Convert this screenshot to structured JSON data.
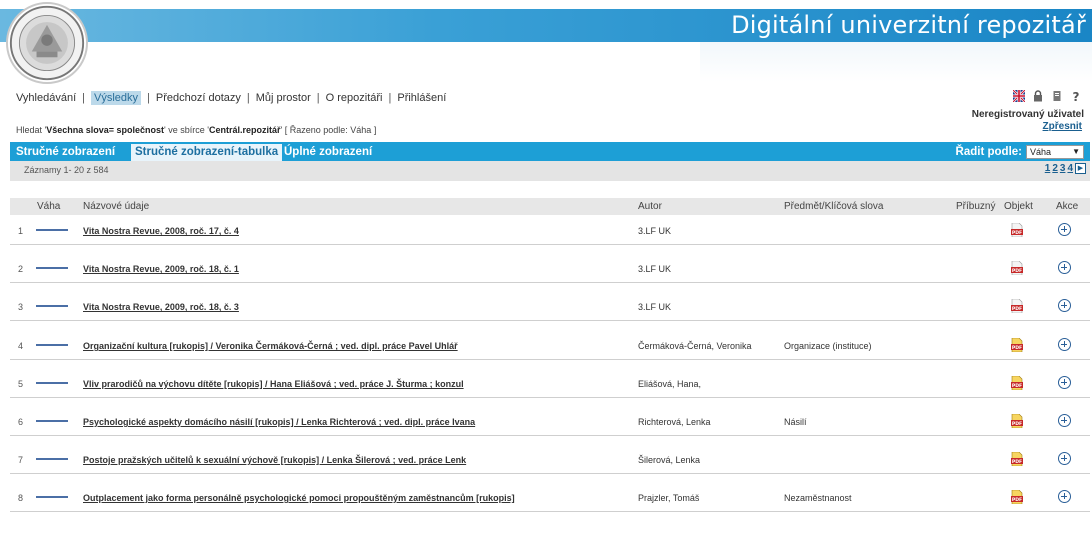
{
  "header": {
    "title": "Digitální univerzitní repozitář"
  },
  "nav": {
    "items": [
      {
        "label": "Vyhledávání"
      },
      {
        "label": "Výsledky"
      },
      {
        "label": "Předchozí dotazy"
      },
      {
        "label": "Můj prostor"
      },
      {
        "label": "O repozitáři"
      },
      {
        "label": "Přihlášení"
      }
    ]
  },
  "user": {
    "label": "Neregistrovaný uživatel",
    "refine": "Zpřesnit"
  },
  "query": {
    "prefix": "Hledat '",
    "term": "Všechna slova= společnost",
    "mid": "' ve sbírce '",
    "collection": "Centrál.repozitář",
    "suffix": "' [ Řazeno podle: Váha ]"
  },
  "tabs": {
    "brief": "Stručné zobrazení",
    "brief_table": "Stručné zobrazení-tabulka",
    "full": "Úplné zobrazení"
  },
  "sort": {
    "label": "Řadit podle:",
    "value": "Váha"
  },
  "records": {
    "count": "Záznamy 1- 20 z 584",
    "pages": [
      "1",
      "2",
      "3",
      "4"
    ]
  },
  "table": {
    "headers": {
      "weight": "Váha",
      "title": "Názvové údaje",
      "author": "Autor",
      "subject": "Předmět/Klíčová slova",
      "related": "Příbuzný",
      "object": "Objekt",
      "action": "Akce"
    },
    "rows": [
      {
        "num": "1",
        "title": "Vita Nostra Revue, 2008, roč. 17, č. 4",
        "author": "3.LF UK",
        "subject": "",
        "weight": 1.0
      },
      {
        "num": "2",
        "title": "Vita Nostra Revue, 2009, roč. 18, č. 1",
        "author": "3.LF UK",
        "subject": "",
        "weight": 1.0
      },
      {
        "num": "3",
        "title": "Vita Nostra Revue, 2009, roč. 18, č. 3",
        "author": "3.LF UK",
        "subject": "",
        "weight": 1.0
      },
      {
        "num": "4",
        "title": "Organizační kultura [rukopis] / Veronika Čermáková-Černá ; ved. dipl. práce Pavel Uhlář",
        "author": "Čermáková-Černá, Veronika",
        "subject": "Organizace (instituce)",
        "weight": 1.0
      },
      {
        "num": "5",
        "title": "Vliv prarodičů na výchovu dítěte [rukopis] / Hana Eliášová ; ved. práce J. Šturma ; konzul",
        "author": "Eliášová, Hana,",
        "subject": "",
        "weight": 1.0
      },
      {
        "num": "6",
        "title": "Psychologické aspekty domácího násilí [rukopis] / Lenka Richterová ; ved. dipl. práce Ivana",
        "author": "Richterová, Lenka",
        "subject": "Násilí",
        "weight": 1.0
      },
      {
        "num": "7",
        "title": "Postoje pražských učitelů k sexuální výchově [rukopis] / Lenka Šilerová ; ved. práce Lenk",
        "author": "Šilerová, Lenka",
        "subject": "",
        "weight": 1.0
      },
      {
        "num": "8",
        "title": "Outplacement jako forma personálně psychologické pomoci propouštěným zaměstnancům [rukopis]",
        "author": "Prajzler, Tomáš",
        "subject": "Nezaměstnanost",
        "weight": 1.0
      }
    ]
  },
  "colors": {
    "banner": "#1d9fd6",
    "link": "#1a5f8f",
    "weight_bar": "#4b6fa6"
  }
}
